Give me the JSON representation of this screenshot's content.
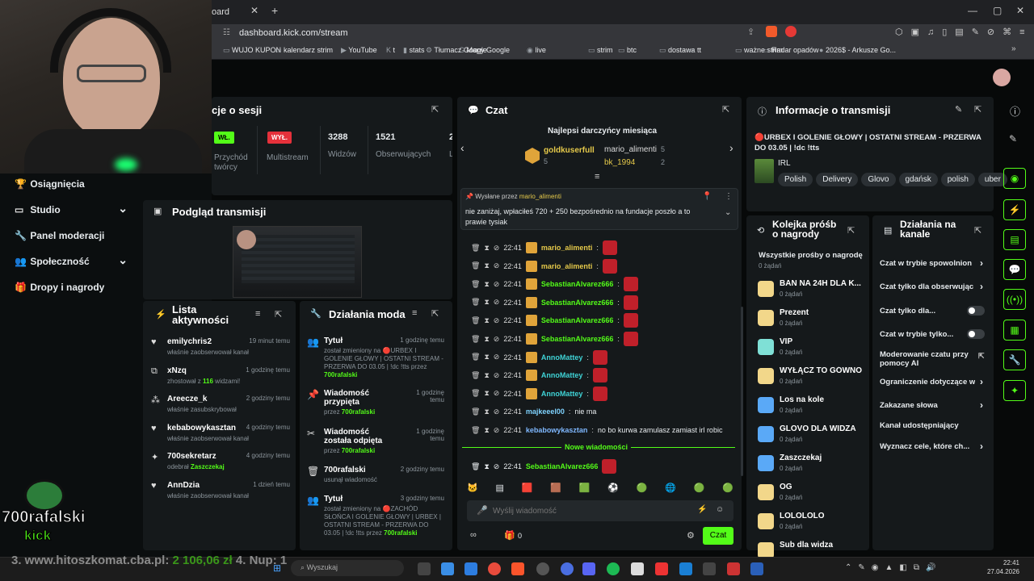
{
  "browser": {
    "tab_title": "oard",
    "tab_close": "✕",
    "new_tab": "+",
    "url": "dashboard.kick.com/stream",
    "bookmarks": [
      "WUJO KUPON",
      "kalendarz strim",
      "YouTube",
      "t",
      "stats",
      "Tłumacz Google",
      "Mapy Google",
      "live",
      "strim",
      "btc",
      "dostawa",
      "tt",
      "ważne strim",
      "Radar opadów",
      "2026$ - Arkusze Go..."
    ]
  },
  "sidebar": {
    "items": [
      {
        "label": "Osiągnięcia",
        "icon": "trophy-icon"
      },
      {
        "label": "Studio",
        "icon": "studio-icon",
        "chevron": "⌄"
      },
      {
        "label": "Panel moderacji",
        "icon": "wrench-icon"
      },
      {
        "label": "Społeczność",
        "icon": "community-icon",
        "chevron": "⌄"
      },
      {
        "label": "Dropy i nagrody",
        "icon": "gift-icon"
      }
    ]
  },
  "session": {
    "title": "cje o sesji",
    "stats": [
      {
        "badge": "WŁ.",
        "label": "Przychód twórcy",
        "badge_color": "#53fc18"
      },
      {
        "badge": "WYŁ.",
        "label": "Multistream",
        "badge_color": "#e5313b"
      },
      {
        "value": "3288",
        "label": "Widzów"
      },
      {
        "value": "1521",
        "label": "Obserwujących"
      },
      {
        "value": "2",
        "label": "L"
      }
    ]
  },
  "preview": {
    "title": "Podgląd transmisji"
  },
  "activity": {
    "title": "Lista aktywności",
    "items": [
      {
        "name": "emilychris2",
        "desc": "właśnie zaobserwował kanał",
        "time": "19 minut temu",
        "icon": "heart-icon"
      },
      {
        "name": "xNzq",
        "desc_pre": "zhostował z ",
        "desc_num": "116",
        "desc_post": " widzami!",
        "time": "1 godzinę temu",
        "icon": "host-icon"
      },
      {
        "name": "Areecze_k",
        "desc": "właśnie zasubskrybował",
        "time": "2 godziny temu",
        "icon": "sub-icon"
      },
      {
        "name": "kebabowykasztan",
        "desc": "właśnie zaobserwował kanał",
        "time": "4 godziny temu",
        "icon": "heart-icon"
      },
      {
        "name": "700sekretarz",
        "desc_pre": "odebrał ",
        "desc_hl": "Zaszczekaj",
        "time": "4 godziny temu",
        "icon": "reward-icon"
      },
      {
        "name": "AnnDzia",
        "desc": "właśnie zaobserwował kanał",
        "time": "1 dzień temu",
        "icon": "heart-icon"
      }
    ]
  },
  "modactions": {
    "title": "Działania moda",
    "items": [
      {
        "name": "Tytuł",
        "time": "1 godzinę temu",
        "desc": "został zmieniony na 🔴URBEX I GOLENIE GŁOWY | OSTATNI STREAM - PRZERWA DO 03.05 | !dc !tts przez",
        "by": "700rafalski",
        "icon": "people-icon"
      },
      {
        "name": "Wiadomość przypięta",
        "time": "1 godzinę temu",
        "desc": "przez",
        "by": "700rafalski",
        "icon": "pin-icon"
      },
      {
        "name": "Wiadomość została odpięta",
        "time": "1 godzinę temu",
        "desc": "przez",
        "by": "700rafalski",
        "icon": "unpin-icon"
      },
      {
        "name": "700rafalski",
        "time": "2 godziny temu",
        "desc": "usunął wiadomość",
        "by": "",
        "icon": "trash-icon"
      },
      {
        "name": "Tytuł",
        "time": "3 godziny temu",
        "desc": "został zmieniony na 🔴ZACHÓD SŁOŃCA I GOLENIE GŁOWY | URBEX | OSTATNI STREAM - PRZERWA DO 03.05 | !dc !tts przez",
        "by": "700rafalski",
        "icon": "people-icon"
      }
    ]
  },
  "chat": {
    "title": "Czat",
    "top_donors_title": "Najlepsi darczyńcy miesiąca",
    "donors": [
      {
        "name": "goldkuserfull",
        "count": "5"
      },
      {
        "name": "mario_alimenti",
        "count": "5"
      },
      {
        "name": "bk_1994",
        "count": "2"
      }
    ],
    "pinned": {
      "label": "Wysłane przez",
      "user": "mario_alimenti",
      "text": "nie zaniżaj, wpłaciłeś 720 + 250 bezpośrednio na fundacje poszło a to prawie tysiak"
    },
    "messages": [
      {
        "time": "22:41",
        "user": "mario_alimenti",
        "color": "#e5c94a",
        "text": ""
      },
      {
        "time": "22:41",
        "user": "mario_alimenti",
        "color": "#e5c94a",
        "text": ""
      },
      {
        "time": "22:41",
        "user": "SebastianAlvarez666",
        "color": "#53fc18",
        "text": ""
      },
      {
        "time": "22:41",
        "user": "SebastianAlvarez666",
        "color": "#53fc18",
        "text": ""
      },
      {
        "time": "22:41",
        "user": "SebastianAlvarez666",
        "color": "#53fc18",
        "text": ""
      },
      {
        "time": "22:41",
        "user": "SebastianAlvarez666",
        "color": "#53fc18",
        "text": ""
      },
      {
        "time": "22:41",
        "user": "AnnoMattey",
        "color": "#3fd3d6",
        "text": ""
      },
      {
        "time": "22:41",
        "user": "AnnoMattey",
        "color": "#3fd3d6",
        "text": ""
      },
      {
        "time": "22:41",
        "user": "AnnoMattey",
        "color": "#3fd3d6",
        "text": ""
      },
      {
        "time": "22:41",
        "user": "majkeeel00",
        "color": "#7fd3ff",
        "text": "nie ma"
      },
      {
        "time": "22:41",
        "user": "kebabowykasztan",
        "color": "#7fb8ff",
        "text": "no bo kurwa zamulasz zamiast irl robic"
      }
    ],
    "new_messages_label": "Nowe wiadomości",
    "last_message": {
      "time": "22:41",
      "user": "SebastianAlvarez666",
      "color": "#53fc18"
    },
    "input_placeholder": "Wyślij wiadomość",
    "send_label": "Czat",
    "viewer_count": "0"
  },
  "stream_info": {
    "title": "Informacje o transmisji",
    "stream_title": "🔴URBEX I GOLENIE GŁOWY | OSTATNI STREAM - PRZERWA DO 03.05 | !dc !tts",
    "category": "IRL",
    "tags": [
      "Polish",
      "Delivery",
      "Glovo",
      "gdańsk",
      "polish",
      "uber"
    ]
  },
  "rewards": {
    "title": "Kolejka próśb o nagrody",
    "filter": "Wszystkie prośby o nagrodę",
    "filter_count": "0 żądań",
    "items": [
      {
        "name": "BAN NA 24H DLA K...",
        "count": "0 żądań",
        "color": "#f2d78a"
      },
      {
        "name": "Prezent",
        "count": "0 żądań",
        "color": "#f2d78a"
      },
      {
        "name": "VIP",
        "count": "0 żądań",
        "color": "#7fe0d6"
      },
      {
        "name": "WYŁĄCZ TO GÓWNO",
        "count": "0 żądań",
        "color": "#f2d78a"
      },
      {
        "name": "Los na kole",
        "count": "0 żądań",
        "color": "#5aa9f7"
      },
      {
        "name": "GLOVO DLA WIDZA",
        "count": "0 żądań",
        "color": "#5aa9f7"
      },
      {
        "name": "Zaszczekaj",
        "count": "0 żądań",
        "color": "#5aa9f7"
      },
      {
        "name": "OG",
        "count": "0 żądań",
        "color": "#f2d78a"
      },
      {
        "name": "LOLOLOLO",
        "count": "0 żądań",
        "color": "#f2d78a"
      },
      {
        "name": "Sub dla widza",
        "count": "",
        "color": "#f2d78a"
      }
    ]
  },
  "channel_actions": {
    "title": "Działania na kanale",
    "items": [
      {
        "label": "Czat w trybie spowolnion",
        "type": "chevron"
      },
      {
        "label": "Czat tylko dla obserwując",
        "type": "chevron"
      },
      {
        "label": "Czat tylko dla...",
        "type": "toggle"
      },
      {
        "label": "Czat w trybie tylko...",
        "type": "toggle"
      },
      {
        "label": "Moderowanie czatu przy pomocy AI",
        "type": "external"
      },
      {
        "label": "Ograniczenie dotyczące w",
        "type": "chevron"
      },
      {
        "label": "Zakazane słowa",
        "type": "chevron"
      },
      {
        "label": "Kanał udostępniający",
        "type": "none"
      },
      {
        "label": "Wyznacz cele, które ch...",
        "type": "chevron"
      }
    ]
  },
  "overlay": {
    "logo_text": "700rafalski",
    "logo_sub": "kick",
    "ticker_pre": "3. www.hitoszkomat.cba.pl: ",
    "ticker_amount": "2 106,06 zł",
    "ticker_post": " 4. Nup: 1"
  },
  "taskbar": {
    "search_placeholder": "Wyszukaj",
    "time": "22:41",
    "date": "27.04.2026"
  }
}
